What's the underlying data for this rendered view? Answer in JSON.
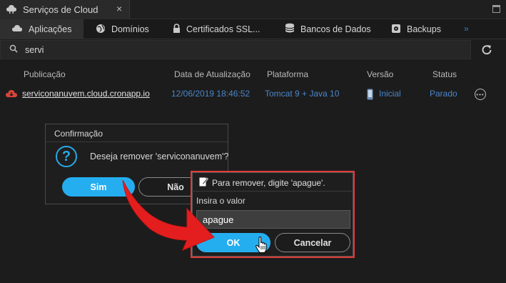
{
  "window": {
    "title": "Serviços de Cloud",
    "close_glyph": "×"
  },
  "tabs": [
    {
      "label": "Aplicações",
      "icon": "cloud-icon"
    },
    {
      "label": "Domínios",
      "icon": "globe-icon"
    },
    {
      "label": "Certificados SSL...",
      "icon": "lock-icon"
    },
    {
      "label": "Bancos de Dados",
      "icon": "database-icon"
    },
    {
      "label": "Backups",
      "icon": "disk-icon"
    }
  ],
  "tabs_more": "»",
  "search": {
    "value": "servi"
  },
  "table": {
    "headers": [
      "Publicação",
      "Data de Atualização",
      "Plataforma",
      "Versão",
      "Status"
    ],
    "rows": [
      {
        "publication": "serviconanuvem.cloud.cronapp.io",
        "updated": "12/06/2019 18:46:52",
        "platform": "Tomcat 9 + Java 10",
        "version": "Inicial",
        "status": "Parado"
      }
    ]
  },
  "confirm_dialog": {
    "title": "Confirmação",
    "message": "Deseja remover 'serviconanuvem'?",
    "yes_label": "Sim",
    "no_label": "Não"
  },
  "prompt_dialog": {
    "title": "Para remover, digite 'apague'.",
    "field_label": "Insira o valor",
    "input_value": "apague",
    "ok_label": "OK",
    "cancel_label": "Cancelar"
  },
  "colors": {
    "accent": "#24aef0",
    "highlight_border": "#e23a3a",
    "arrow": "#e41e1e",
    "link_blue": "#4a86c9"
  }
}
